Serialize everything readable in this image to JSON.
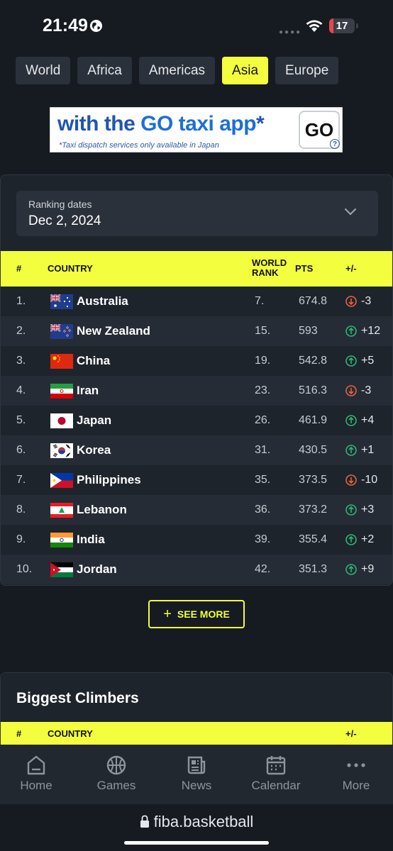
{
  "status_bar": {
    "time": "21:49",
    "battery": "17",
    "battery_level": 0.17
  },
  "region_tabs": [
    {
      "label": "World",
      "active": false
    },
    {
      "label": "Africa",
      "active": false
    },
    {
      "label": "Americas",
      "active": false
    },
    {
      "label": "Asia",
      "active": true
    },
    {
      "label": "Europe",
      "active": false
    }
  ],
  "ad": {
    "headline_pre": "with the ",
    "headline_big": "GO taxi app",
    "headline_star": "*",
    "subtext": "*Taxi dispatch services only available in Japan",
    "logo_text": "GO",
    "info_icon": "?"
  },
  "ranking": {
    "date_label": "Ranking dates",
    "date_value": "Dec 2, 2024",
    "headers": {
      "rank": "#",
      "country": "COUNTRY",
      "world_rank_1": "WORLD",
      "world_rank_2": "RANK",
      "pts": "PTS",
      "change": "+/-"
    },
    "rows": [
      {
        "rank": "1.",
        "country": "Australia",
        "flag": "australia-flag",
        "world_rank": "7.",
        "pts": "674.8",
        "direction": "down",
        "change": "-3"
      },
      {
        "rank": "2.",
        "country": "New Zealand",
        "flag": "new-zealand-flag",
        "world_rank": "15.",
        "pts": "593",
        "direction": "up",
        "change": "+12"
      },
      {
        "rank": "3.",
        "country": "China",
        "flag": "china-flag",
        "world_rank": "19.",
        "pts": "542.8",
        "direction": "up",
        "change": "+5"
      },
      {
        "rank": "4.",
        "country": "Iran",
        "flag": "iran-flag",
        "world_rank": "23.",
        "pts": "516.3",
        "direction": "down",
        "change": "-3"
      },
      {
        "rank": "5.",
        "country": "Japan",
        "flag": "japan-flag",
        "world_rank": "26.",
        "pts": "461.9",
        "direction": "up",
        "change": "+4"
      },
      {
        "rank": "6.",
        "country": "Korea",
        "flag": "korea-flag",
        "world_rank": "31.",
        "pts": "430.5",
        "direction": "up",
        "change": "+1"
      },
      {
        "rank": "7.",
        "country": "Philippines",
        "flag": "philippines-flag",
        "world_rank": "35.",
        "pts": "373.5",
        "direction": "down",
        "change": "-10"
      },
      {
        "rank": "8.",
        "country": "Lebanon",
        "flag": "lebanon-flag",
        "world_rank": "36.",
        "pts": "373.2",
        "direction": "up",
        "change": "+3"
      },
      {
        "rank": "9.",
        "country": "India",
        "flag": "india-flag",
        "world_rank": "39.",
        "pts": "355.4",
        "direction": "up",
        "change": "+2"
      },
      {
        "rank": "10.",
        "country": "Jordan",
        "flag": "jordan-flag",
        "world_rank": "42.",
        "pts": "351.3",
        "direction": "up",
        "change": "+9"
      }
    ],
    "see_more": "SEE MORE",
    "colors": {
      "accent": "#f3ff3e",
      "up": "#2bb673",
      "down": "#e8623d"
    }
  },
  "climbers": {
    "title": "Biggest Climbers",
    "headers": {
      "rank": "#",
      "country": "COUNTRY",
      "change": "+/-"
    }
  },
  "bottom_nav": [
    {
      "label": "Home",
      "icon": "home-icon"
    },
    {
      "label": "Games",
      "icon": "basketball-icon"
    },
    {
      "label": "News",
      "icon": "newspaper-icon"
    },
    {
      "label": "Calendar",
      "icon": "calendar-icon"
    },
    {
      "label": "More",
      "icon": "more-icon"
    }
  ],
  "url_bar": {
    "url": "fiba.basketball"
  }
}
